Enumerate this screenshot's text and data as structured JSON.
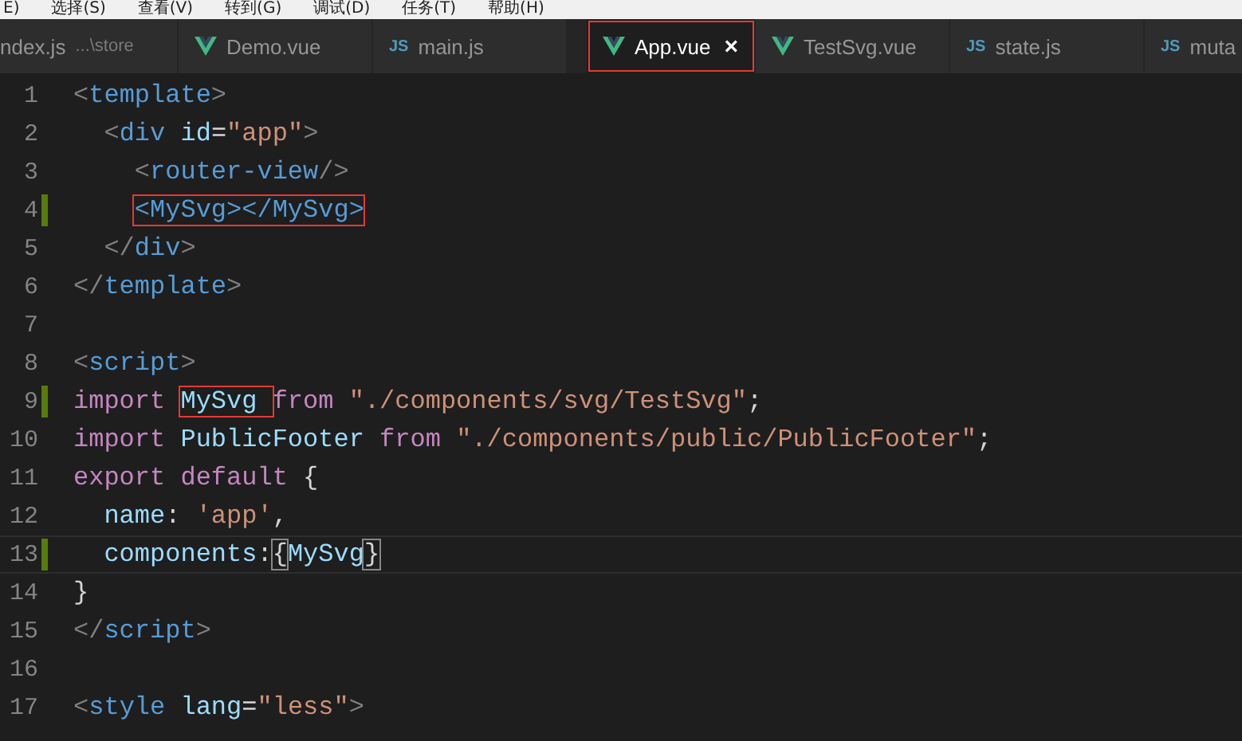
{
  "menu_bar": [
    "E)",
    "选择(S)",
    "查看(V)",
    "转到(G)",
    "调试(D)",
    "任务(T)",
    "帮助(H)"
  ],
  "tabs": [
    {
      "label": "ndex.js",
      "description": "...\\store",
      "kind": "plain",
      "selected": false,
      "boxed": false
    },
    {
      "label": "Demo.vue",
      "kind": "vue",
      "selected": false,
      "boxed": false
    },
    {
      "label": "main.js",
      "kind": "js",
      "icon_text": "JS",
      "selected": false,
      "boxed": false
    },
    {
      "label": "App.vue",
      "kind": "vue",
      "selected": true,
      "boxed": true,
      "close": "×"
    },
    {
      "label": "TestSvg.vue",
      "kind": "vue",
      "selected": false,
      "boxed": false
    },
    {
      "label": "state.js",
      "kind": "js",
      "icon_text": "JS",
      "selected": false,
      "boxed": false
    },
    {
      "label": "muta",
      "kind": "js",
      "icon_text": "JS",
      "selected": false,
      "boxed": false
    }
  ],
  "lines": [
    {
      "number": "1",
      "modified": false,
      "current": false,
      "tokens": [
        {
          "kind": "punct",
          "text": "<"
        },
        {
          "kind": "tag",
          "text": "template"
        },
        {
          "kind": "punct",
          "text": ">"
        }
      ]
    },
    {
      "number": "2",
      "modified": false,
      "current": false,
      "tokens": [
        {
          "kind": "punct",
          "text": "  <"
        },
        {
          "kind": "tag",
          "text": "div"
        },
        {
          "kind": "attr",
          "text": " id"
        },
        {
          "kind": "plain",
          "text": "="
        },
        {
          "kind": "string",
          "text": "\"app\""
        },
        {
          "kind": "punct",
          "text": ">"
        }
      ]
    },
    {
      "number": "3",
      "modified": false,
      "current": false,
      "tokens": [
        {
          "kind": "punct",
          "text": "    <"
        },
        {
          "kind": "tag",
          "text": "router-view"
        },
        {
          "kind": "punct",
          "text": "/>"
        }
      ]
    },
    {
      "number": "4",
      "modified": true,
      "current": false,
      "tokens": [
        {
          "kind": "tag",
          "text": "<MySvg></MySvg>",
          "boxed": true,
          "indented": true
        }
      ]
    },
    {
      "number": "5",
      "modified": false,
      "current": false,
      "tokens": [
        {
          "kind": "punct",
          "text": "  </"
        },
        {
          "kind": "tag",
          "text": "div"
        },
        {
          "kind": "punct",
          "text": ">"
        }
      ]
    },
    {
      "number": "6",
      "modified": false,
      "current": false,
      "tokens": [
        {
          "kind": "punct",
          "text": "</"
        },
        {
          "kind": "tag",
          "text": "template"
        },
        {
          "kind": "punct",
          "text": ">"
        }
      ]
    },
    {
      "number": "7",
      "modified": false,
      "current": false
    },
    {
      "number": "8",
      "modified": false,
      "current": false,
      "tokens": [
        {
          "kind": "punct",
          "text": "<"
        },
        {
          "kind": "tag",
          "text": "script"
        },
        {
          "kind": "punct",
          "text": ">"
        }
      ]
    },
    {
      "number": "9",
      "modified": true,
      "current": false,
      "tokens": [
        {
          "kind": "keyword",
          "text": "import "
        },
        {
          "kind": "variable",
          "text": "MySvg ",
          "boxed": true
        },
        {
          "kind": "keyword",
          "text": "from "
        },
        {
          "kind": "string",
          "text": "\"./components/svg/TestSvg\""
        },
        {
          "kind": "plain",
          "text": ";"
        }
      ]
    },
    {
      "number": "10",
      "modified": false,
      "current": false,
      "tokens": [
        {
          "kind": "keyword",
          "text": "import "
        },
        {
          "kind": "variable",
          "text": "PublicFooter "
        },
        {
          "kind": "keyword",
          "text": "from "
        },
        {
          "kind": "string",
          "text": "\"./components/public/PublicFooter\""
        },
        {
          "kind": "plain",
          "text": ";"
        }
      ]
    },
    {
      "number": "11",
      "modified": false,
      "current": false,
      "tokens": [
        {
          "kind": "keyword",
          "text": "export default "
        },
        {
          "kind": "plain",
          "text": "{"
        }
      ]
    },
    {
      "number": "12",
      "modified": false,
      "current": false,
      "tokens": [
        {
          "kind": "variable",
          "text": "  name"
        },
        {
          "kind": "plain",
          "text": ": "
        },
        {
          "kind": "string",
          "text": "'app'"
        },
        {
          "kind": "plain",
          "text": ","
        }
      ]
    },
    {
      "number": "13",
      "modified": true,
      "current": true,
      "tokens": [
        {
          "kind": "variable",
          "text": "  components"
        },
        {
          "kind": "plain",
          "text": ":"
        },
        {
          "kind": "bracket",
          "text": "{"
        },
        {
          "kind": "variable",
          "text": "MySvg"
        },
        {
          "kind": "bracket",
          "text": "}"
        }
      ]
    },
    {
      "number": "14",
      "modified": false,
      "current": false,
      "tokens": [
        {
          "kind": "plain",
          "text": "}"
        }
      ]
    },
    {
      "number": "15",
      "modified": false,
      "current": false,
      "tokens": [
        {
          "kind": "punct",
          "text": "</"
        },
        {
          "kind": "tag",
          "text": "script"
        },
        {
          "kind": "punct",
          "text": ">"
        }
      ]
    },
    {
      "number": "16",
      "modified": false,
      "current": false
    },
    {
      "number": "17",
      "modified": false,
      "current": false,
      "tokens": [
        {
          "kind": "punct",
          "text": "<"
        },
        {
          "kind": "tag",
          "text": "style"
        },
        {
          "kind": "attr",
          "text": " lang"
        },
        {
          "kind": "plain",
          "text": "="
        },
        {
          "kind": "string",
          "text": "\"less\""
        },
        {
          "kind": "punct",
          "text": ">"
        }
      ]
    }
  ]
}
